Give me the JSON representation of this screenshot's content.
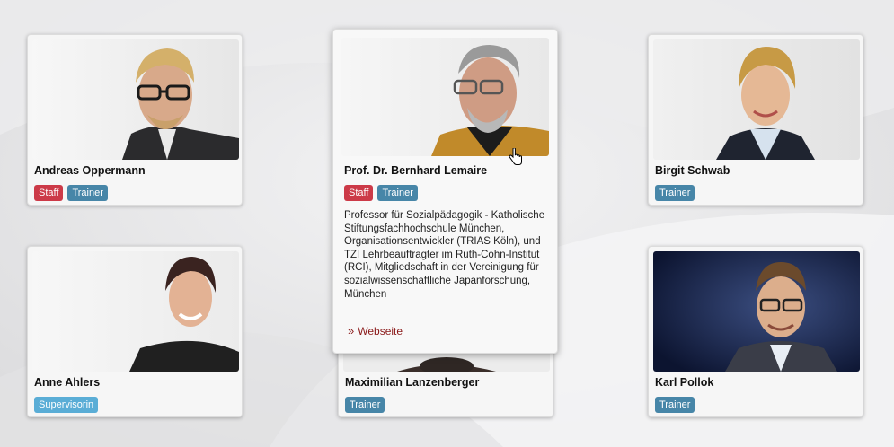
{
  "people": [
    {
      "name": "Andreas Oppermann",
      "tags": [
        "Staff",
        "Trainer"
      ]
    },
    {
      "name": "Prof. Dr. Bernhard Lemaire",
      "tags": [
        "Staff",
        "Trainer"
      ],
      "description": "Professor für Sozialpädagogik - Katholische Stiftungsfachhochschule München, Organisationsentwickler (TRIAS Köln), und TZI Lehrbeauftragter im Ruth-Cohn-Institut (RCI), Mitgliedschaft in der Vereinigung für sozialwissenschaftliche Japanforschung, München",
      "link_label": "Webseite"
    },
    {
      "name": "Birgit Schwab",
      "tags": [
        "Trainer"
      ]
    },
    {
      "name": "Anne Ahlers",
      "tags": [
        "Supervisorin"
      ]
    },
    {
      "name": "Maximilian Lanzenberger",
      "tags": [
        "Trainer"
      ]
    },
    {
      "name": "Karl Pollok",
      "tags": [
        "Trainer"
      ]
    }
  ],
  "colors": {
    "staff": "#cc3a48",
    "trainer": "#4786a8",
    "supervisor": "#5aadd6",
    "link": "#8b1a1a"
  },
  "icons": {
    "cursor": "hand-pointer-icon",
    "link_marker": "double-chevron-right-icon"
  }
}
